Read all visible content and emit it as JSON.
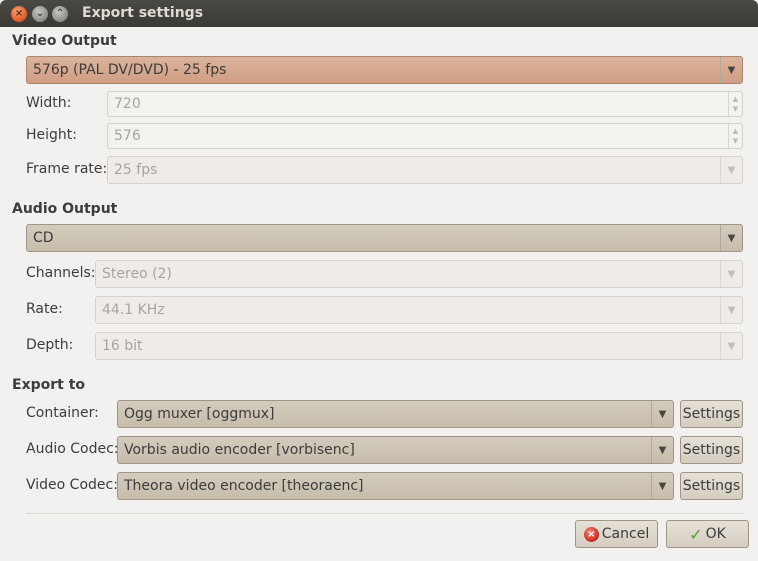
{
  "window": {
    "title": "Export settings",
    "close_glyph": "×",
    "minimize_glyph": "⌄",
    "maximize_glyph": "⌃"
  },
  "video_output": {
    "heading": "Video Output",
    "preset": "576p (PAL DV/DVD) - 25 fps",
    "width_label": "Width:",
    "width_value": "720",
    "height_label": "Height:",
    "height_value": "576",
    "framerate_label": "Frame rate:",
    "framerate_value": "25 fps"
  },
  "audio_output": {
    "heading": "Audio Output",
    "preset": "CD",
    "channels_label": "Channels:",
    "channels_value": "Stereo (2)",
    "rate_label": "Rate:",
    "rate_value": "44.1 KHz",
    "depth_label": "Depth:",
    "depth_value": "16 bit"
  },
  "export_to": {
    "heading": "Export to",
    "container_label": "Container:",
    "container_value": "Ogg muxer [oggmux]",
    "audio_codec_label": "Audio Codec:",
    "audio_codec_value": "Vorbis audio encoder [vorbisenc]",
    "video_codec_label": "Video Codec:",
    "video_codec_value": "Theora video encoder [theoraenc]",
    "settings_label": "Settings"
  },
  "buttons": {
    "cancel": "Cancel",
    "ok": "OK"
  },
  "icons": {
    "dropdown": "chevron-down-icon",
    "cancel": "cancel-icon",
    "ok": "checkmark-icon"
  },
  "colors": {
    "titlebar": "#3c3b37",
    "close_button": "#e2561f",
    "active_combo": "#d4a58b",
    "window_bg": "#f2f1f0"
  }
}
